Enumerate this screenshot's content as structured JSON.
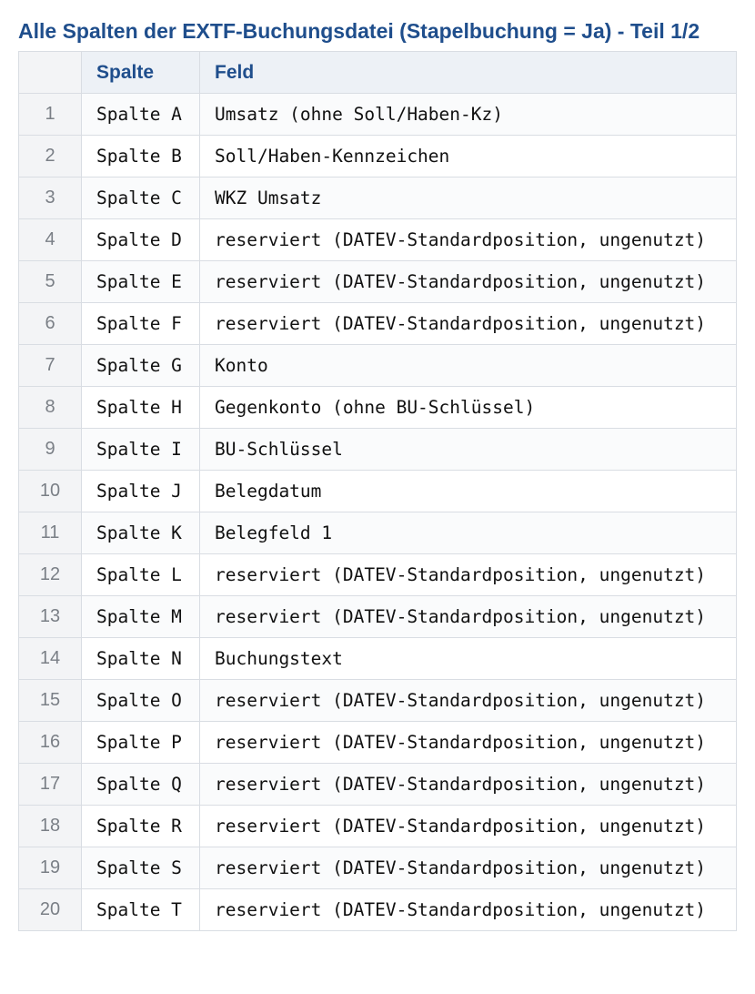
{
  "title": "Alle Spalten der EXTF-Buchungsdatei (Stapelbuchung = Ja) - Teil 1/2",
  "table": {
    "headers": [
      "",
      "Spalte",
      "Feld"
    ],
    "rows": [
      {
        "index": "1",
        "spalte": "Spalte A",
        "feld": "Umsatz (ohne Soll/Haben-Kz)"
      },
      {
        "index": "2",
        "spalte": "Spalte B",
        "feld": "Soll/Haben-Kennzeichen"
      },
      {
        "index": "3",
        "spalte": "Spalte C",
        "feld": "WKZ Umsatz"
      },
      {
        "index": "4",
        "spalte": "Spalte D",
        "feld": "reserviert (DATEV-Standardposition, ungenutzt)"
      },
      {
        "index": "5",
        "spalte": "Spalte E",
        "feld": "reserviert (DATEV-Standardposition, ungenutzt)"
      },
      {
        "index": "6",
        "spalte": "Spalte F",
        "feld": "reserviert (DATEV-Standardposition, ungenutzt)"
      },
      {
        "index": "7",
        "spalte": "Spalte G",
        "feld": "Konto"
      },
      {
        "index": "8",
        "spalte": "Spalte H",
        "feld": "Gegenkonto (ohne BU-Schlüssel)"
      },
      {
        "index": "9",
        "spalte": "Spalte I",
        "feld": "BU-Schlüssel"
      },
      {
        "index": "10",
        "spalte": "Spalte J",
        "feld": "Belegdatum"
      },
      {
        "index": "11",
        "spalte": "Spalte K",
        "feld": "Belegfeld 1"
      },
      {
        "index": "12",
        "spalte": "Spalte L",
        "feld": "reserviert (DATEV-Standardposition, ungenutzt)"
      },
      {
        "index": "13",
        "spalte": "Spalte M",
        "feld": "reserviert (DATEV-Standardposition, ungenutzt)"
      },
      {
        "index": "14",
        "spalte": "Spalte N",
        "feld": "Buchungstext"
      },
      {
        "index": "15",
        "spalte": "Spalte O",
        "feld": "reserviert (DATEV-Standardposition, ungenutzt)"
      },
      {
        "index": "16",
        "spalte": "Spalte P",
        "feld": "reserviert (DATEV-Standardposition, ungenutzt)"
      },
      {
        "index": "17",
        "spalte": "Spalte Q",
        "feld": "reserviert (DATEV-Standardposition, ungenutzt)"
      },
      {
        "index": "18",
        "spalte": "Spalte R",
        "feld": "reserviert (DATEV-Standardposition, ungenutzt)"
      },
      {
        "index": "19",
        "spalte": "Spalte S",
        "feld": "reserviert (DATEV-Standardposition, ungenutzt)"
      },
      {
        "index": "20",
        "spalte": "Spalte T",
        "feld": "reserviert (DATEV-Standardposition, ungenutzt)"
      }
    ]
  }
}
